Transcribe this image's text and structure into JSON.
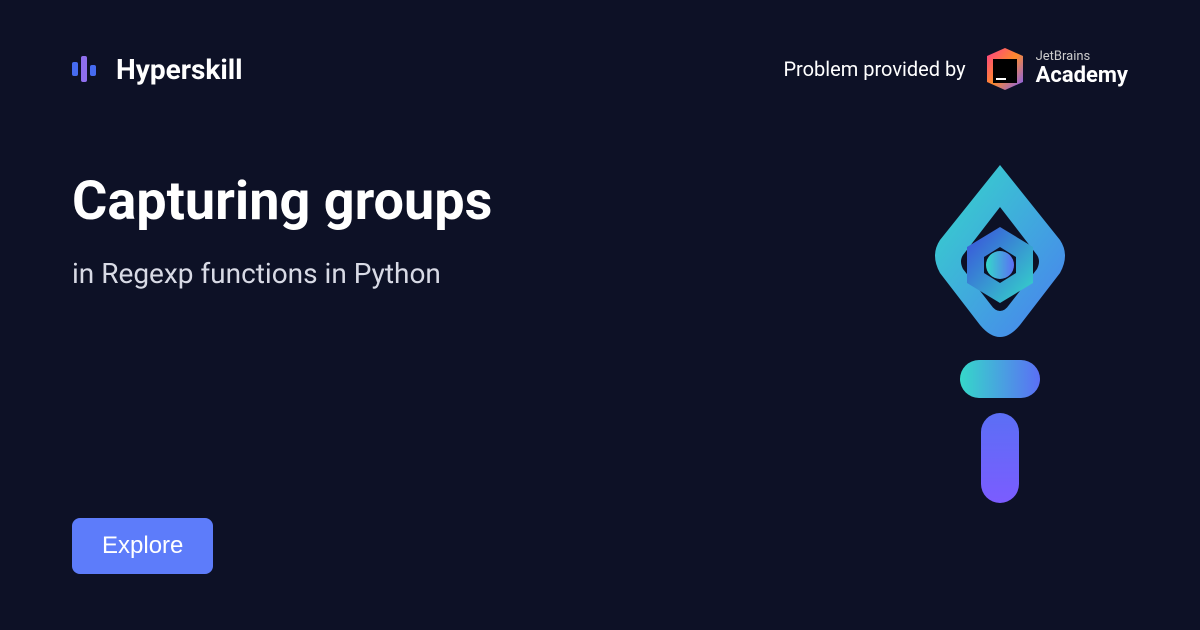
{
  "header": {
    "logo_text": "Hyperskill",
    "provider_label": "Problem provided by",
    "jetbrains_top": "JetBrains",
    "jetbrains_bottom": "Academy"
  },
  "main": {
    "title": "Capturing groups",
    "subtitle": "in Regexp functions in Python"
  },
  "cta": {
    "explore_label": "Explore"
  }
}
